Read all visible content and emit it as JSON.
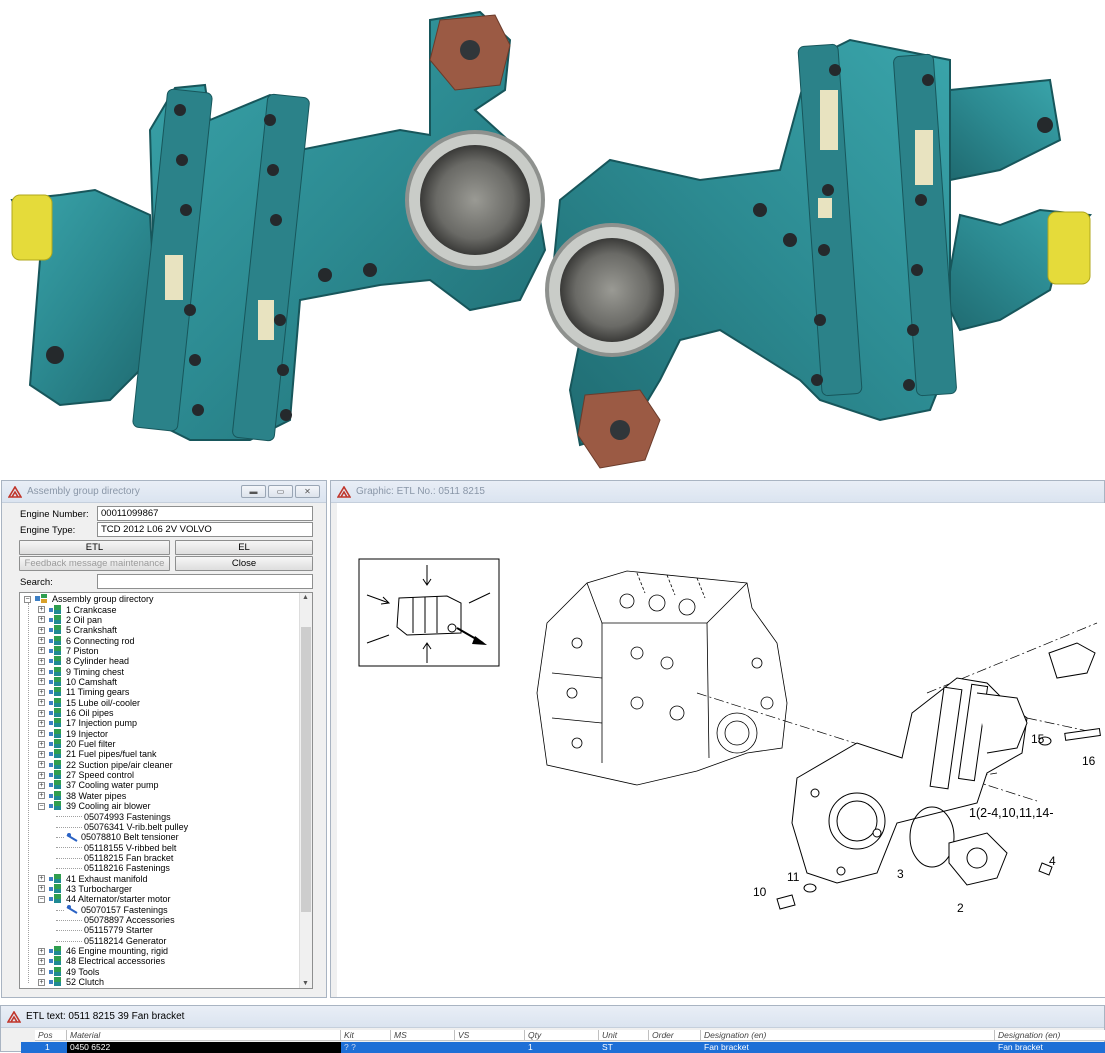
{
  "assembly_window": {
    "title": "Assembly group directory",
    "engine_number_label": "Engine Number:",
    "engine_number_value": "00011099867",
    "engine_type_label": "Engine Type:",
    "engine_type_value": "TCD 2012 L06 2V VOLVO",
    "btn_etl": "ETL",
    "btn_el": "EL",
    "btn_feedback": "Feedback message maintenance",
    "btn_close": "Close",
    "search_label": "Search:",
    "search_value": "",
    "tree_root": "Assembly group directory",
    "tree_items": [
      {
        "label": "1  Crankcase",
        "expanded": false
      },
      {
        "label": "2  Oil pan",
        "expanded": false
      },
      {
        "label": "5  Crankshaft",
        "expanded": false
      },
      {
        "label": "6  Connecting rod",
        "expanded": false
      },
      {
        "label": "7  Piston",
        "expanded": false
      },
      {
        "label": "8  Cylinder head",
        "expanded": false
      },
      {
        "label": "9  Timing chest",
        "expanded": false
      },
      {
        "label": "10  Camshaft",
        "expanded": false
      },
      {
        "label": "11  Timing gears",
        "expanded": false
      },
      {
        "label": "15  Lube oil/-cooler",
        "expanded": false
      },
      {
        "label": "16  Oil pipes",
        "expanded": false
      },
      {
        "label": "17  Injection pump",
        "expanded": false
      },
      {
        "label": "19  Injector",
        "expanded": false
      },
      {
        "label": "20  Fuel filter",
        "expanded": false
      },
      {
        "label": "21  Fuel pipes/fuel tank",
        "expanded": false
      },
      {
        "label": "22  Suction pipe/air cleaner",
        "expanded": false
      },
      {
        "label": "27  Speed control",
        "expanded": false
      },
      {
        "label": "37  Cooling water pump",
        "expanded": false
      },
      {
        "label": "38  Water pipes",
        "expanded": false
      },
      {
        "label": "39  Cooling air blower",
        "expanded": true
      },
      {
        "label": "05074993  Fastenings",
        "child": true
      },
      {
        "label": "05076341  V-rib.belt pulley",
        "child": true
      },
      {
        "label": "05078810  Belt tensioner",
        "child": true,
        "tool": true
      },
      {
        "label": "05118155  V-ribbed belt",
        "child": true
      },
      {
        "label": "05118215  Fan bracket",
        "child": true
      },
      {
        "label": "05118216  Fastenings",
        "child": true
      },
      {
        "label": "41  Exhaust manifold",
        "expanded": false
      },
      {
        "label": "43  Turbocharger",
        "expanded": false
      },
      {
        "label": "44  Alternator/starter motor",
        "expanded": true
      },
      {
        "label": "05070157  Fastenings",
        "child": true,
        "tool": true
      },
      {
        "label": "05078897  Accessories",
        "child": true
      },
      {
        "label": "05115779  Starter",
        "child": true
      },
      {
        "label": "05118214  Generator",
        "child": true
      },
      {
        "label": "46  Engine mounting, rigid",
        "expanded": false
      },
      {
        "label": "48  Electrical accessories",
        "expanded": false
      },
      {
        "label": "49  Tools",
        "expanded": false
      },
      {
        "label": "52  Clutch",
        "expanded": false
      }
    ]
  },
  "graphic_window": {
    "title": "Graphic: ETL No.: 0511 8215",
    "callouts": [
      "15",
      "16",
      "1(2-4,10,11,14-",
      "3",
      "4",
      "11",
      "10",
      "2"
    ]
  },
  "etl_window": {
    "title": "ETL text: 0511 8215   39   Fan bracket",
    "columns": [
      "Pos",
      "Material",
      "Kit",
      "MS",
      "VS",
      "Qty",
      "Unit",
      "Order",
      "Designation (en)",
      "Designation (en)"
    ],
    "row": {
      "pos": "1",
      "material": "0450 6522",
      "kit": "? ?",
      "ms": "",
      "vs": "",
      "qty": "1",
      "unit": "ST",
      "order": "",
      "designation": "Fan bracket",
      "designation2": "Fan bracket"
    }
  },
  "colors": {
    "part_teal": "#2e8e95",
    "window_frame": "#a9b4c2",
    "selection": "#1e6fd6"
  }
}
